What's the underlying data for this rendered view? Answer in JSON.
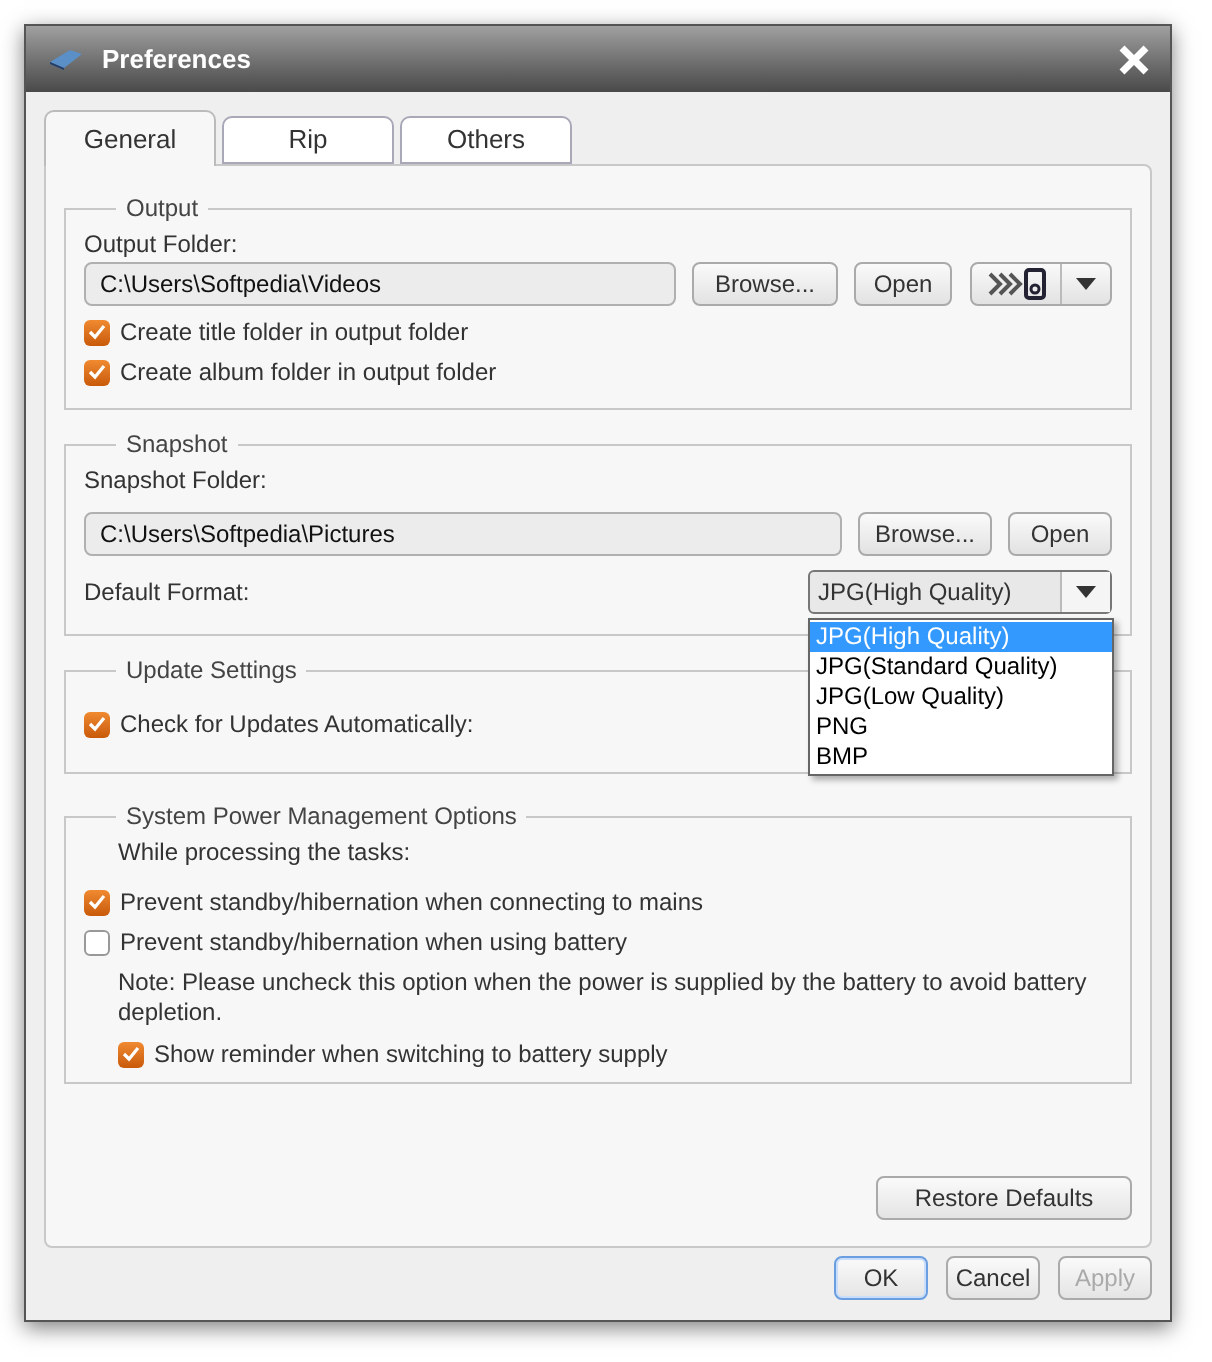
{
  "window": {
    "title": "Preferences"
  },
  "tabs": [
    {
      "label": "General",
      "selected": true
    },
    {
      "label": "Rip",
      "selected": false
    },
    {
      "label": "Others",
      "selected": false
    }
  ],
  "output": {
    "title": "Output",
    "folder_label": "Output Folder:",
    "folder": "C:\\Users\\Softpedia\\Videos",
    "buttons": [
      "Browse...",
      "Open"
    ],
    "options": [
      {
        "label": "Create title folder in output folder",
        "checked": true
      },
      {
        "label": "Create album folder in output folder",
        "checked": true
      }
    ]
  },
  "snapshot": {
    "title": "Snapshot",
    "folder_label": "Snapshot Folder:",
    "folder": "C:\\Users\\Softpedia\\Pictures",
    "buttons": [
      "Browse...",
      "Open"
    ],
    "format_label": "Default Format:",
    "format": "JPG(High Quality)",
    "format_dropdown": {
      "expanded": true,
      "options": [
        {
          "label": "JPG(High Quality)",
          "selected": true
        },
        {
          "label": "JPG(Standard Quality)",
          "selected": false
        },
        {
          "label": "JPG(Low Quality)",
          "selected": false
        },
        {
          "label": "PNG",
          "selected": false
        },
        {
          "label": "BMP",
          "selected": false
        }
      ]
    }
  },
  "update_settings": {
    "title": "Update Settings",
    "options": [
      {
        "label": "Check for Updates Automatically:",
        "checked": true
      }
    ]
  },
  "power": {
    "title": "System Power Management Options",
    "intro": "While processing the tasks:",
    "options": [
      {
        "label": "Prevent standby/hibernation when connecting to mains",
        "checked": true
      },
      {
        "label": "Prevent standby/hibernation when using battery",
        "checked": false
      }
    ],
    "note": "Note: Please uncheck this option when the power is supplied by the battery to avoid battery depletion.",
    "reminder": {
      "label": "Show reminder when switching to battery supply",
      "checked": true
    }
  },
  "restore_button": "Restore Defaults",
  "buttons": [
    {
      "label": "OK",
      "default": true,
      "disabled": false
    },
    {
      "label": "Cancel",
      "default": false,
      "disabled": false
    },
    {
      "label": "Apply",
      "default": false,
      "disabled": true
    }
  ]
}
